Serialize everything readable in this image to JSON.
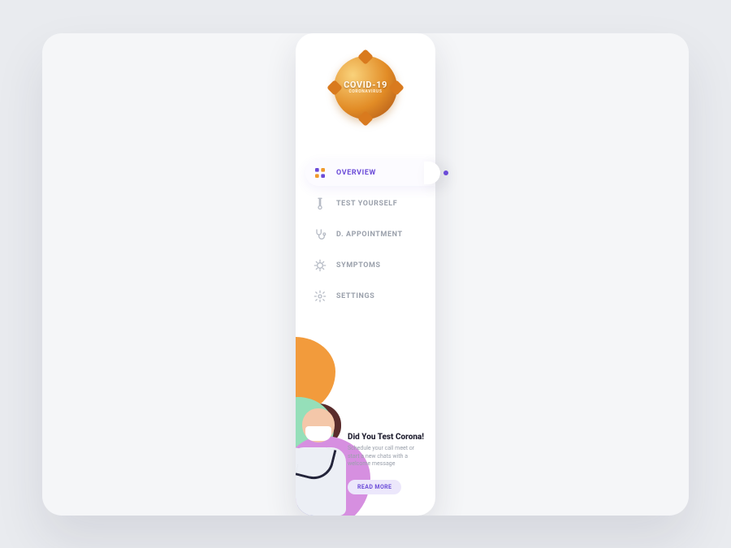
{
  "logo": {
    "line1": "COVID-19",
    "line2": "CORONAVIRUS"
  },
  "nav": {
    "items": [
      {
        "label": "OVERVIEW"
      },
      {
        "label": "TEST YOURSELF"
      },
      {
        "label": "D. APPOINTMENT"
      },
      {
        "label": "SYMPTOMS"
      },
      {
        "label": "SETTINGS"
      }
    ]
  },
  "promo": {
    "title": "Did You Test Corona!",
    "subtitle": "Schedule your call meet or start a new chats with a welcome message",
    "button": "READ MORE"
  },
  "colors": {
    "accent": "#6b4bd8",
    "orange": "#f29b3c",
    "green": "#95dfb9",
    "purple": "#d68fe0"
  }
}
